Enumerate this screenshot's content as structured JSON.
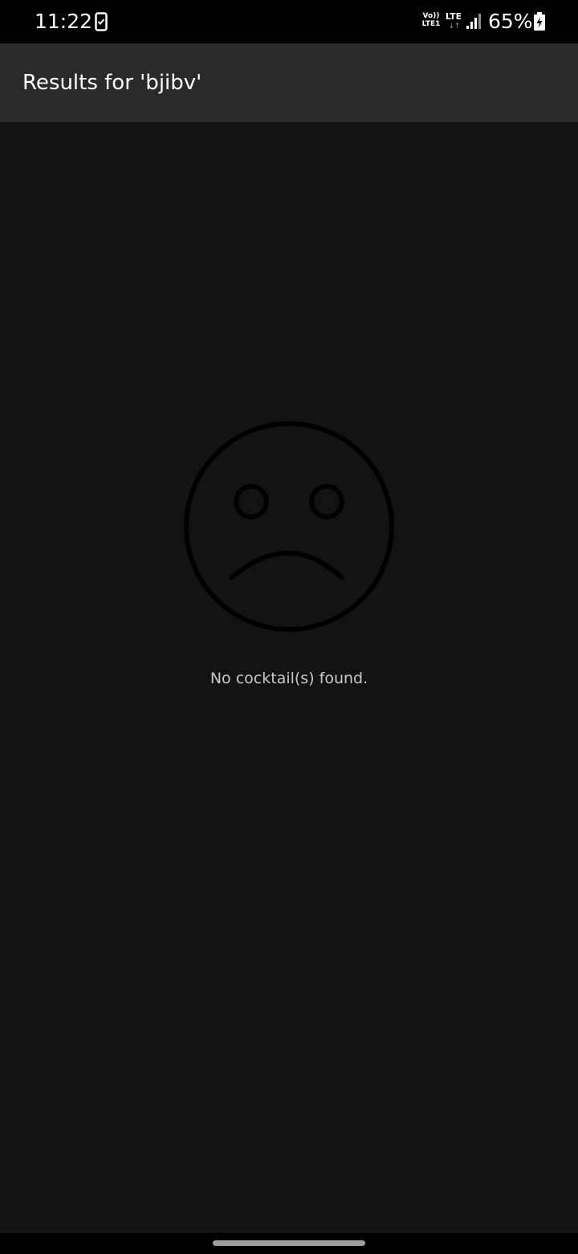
{
  "status_bar": {
    "time": "11:22",
    "volte_line1": "Vo))",
    "volte_line2": "LTE1",
    "network": "LTE",
    "network_arrows": "↓↑",
    "battery": "65%",
    "icons": [
      "phone-notification-icon",
      "signal-icon",
      "battery-charging-icon"
    ]
  },
  "app_bar": {
    "title": "Results for 'bjibv'"
  },
  "empty_state": {
    "icon": "sad-face-icon",
    "message": "No cocktail(s) found."
  },
  "colors": {
    "background": "#131313",
    "app_bar": "#2a2a2a",
    "status_bar": "#000000",
    "text_primary": "#ffffff",
    "text_secondary": "#c8c8c8",
    "icon": "#000000"
  }
}
